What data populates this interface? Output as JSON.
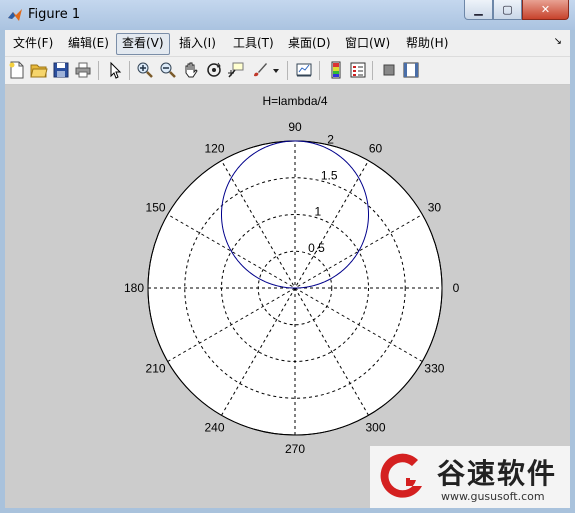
{
  "window": {
    "title": "Figure 1",
    "minimize_label": "▁",
    "maximize_label": "▢",
    "close_label": "✕"
  },
  "menu": [
    {
      "label": "文件(F)"
    },
    {
      "label": "编辑(E)"
    },
    {
      "label": "查看(V)"
    },
    {
      "label": "插入(I)"
    },
    {
      "label": "工具(T)"
    },
    {
      "label": "桌面(D)"
    },
    {
      "label": "窗口(W)"
    },
    {
      "label": "帮助(H)"
    }
  ],
  "menu_overflow_glyph": "↘",
  "toolbar": [
    {
      "icon": "new-figure-icon"
    },
    {
      "icon": "open-file-icon"
    },
    {
      "icon": "save-icon"
    },
    {
      "icon": "print-icon"
    },
    {
      "icon": "edit-plot-arrow-icon"
    },
    {
      "icon": "zoom-in-icon"
    },
    {
      "icon": "zoom-out-icon"
    },
    {
      "icon": "pan-hand-icon"
    },
    {
      "icon": "rotate-3d-icon"
    },
    {
      "icon": "data-cursor-icon"
    },
    {
      "icon": "brush-icon"
    },
    {
      "icon": "brush-dropdown-icon"
    },
    {
      "icon": "link-plot-icon"
    },
    {
      "icon": "insert-colorbar-icon"
    },
    {
      "icon": "insert-legend-icon"
    },
    {
      "icon": "hide-plot-tools-icon"
    },
    {
      "icon": "show-plot-tools-icon"
    }
  ],
  "figure": {
    "background": "#cccccc",
    "axes_background": "#ffffff",
    "grid_color": "#000000",
    "curve_color": "#00008b"
  },
  "chart_data": {
    "type": "polar",
    "title": "H=lambda/4",
    "rmax": 2,
    "radial_ticks": [
      0.5,
      1,
      1.5,
      2
    ],
    "radial_tick_labels": [
      "0.5",
      "1",
      "1.5",
      "2"
    ],
    "angle_ticks_deg": [
      0,
      30,
      60,
      90,
      120,
      150,
      180,
      210,
      240,
      270,
      300,
      330
    ],
    "angle_tick_labels": [
      "0",
      "30",
      "60",
      "90",
      "120",
      "150",
      "180",
      "210",
      "240",
      "270",
      "300",
      "330"
    ],
    "grid": true,
    "series": [
      {
        "description_visible": "closed lobe pointing toward 90 degrees",
        "r_max": 2,
        "direction_deg": 90,
        "shape": "r = 2*sin(theta)",
        "color": "#00008b"
      }
    ]
  },
  "watermark": {
    "brand_cn": "谷速软件",
    "url": "www.gususoft.com",
    "logo_color": "#d42020"
  }
}
